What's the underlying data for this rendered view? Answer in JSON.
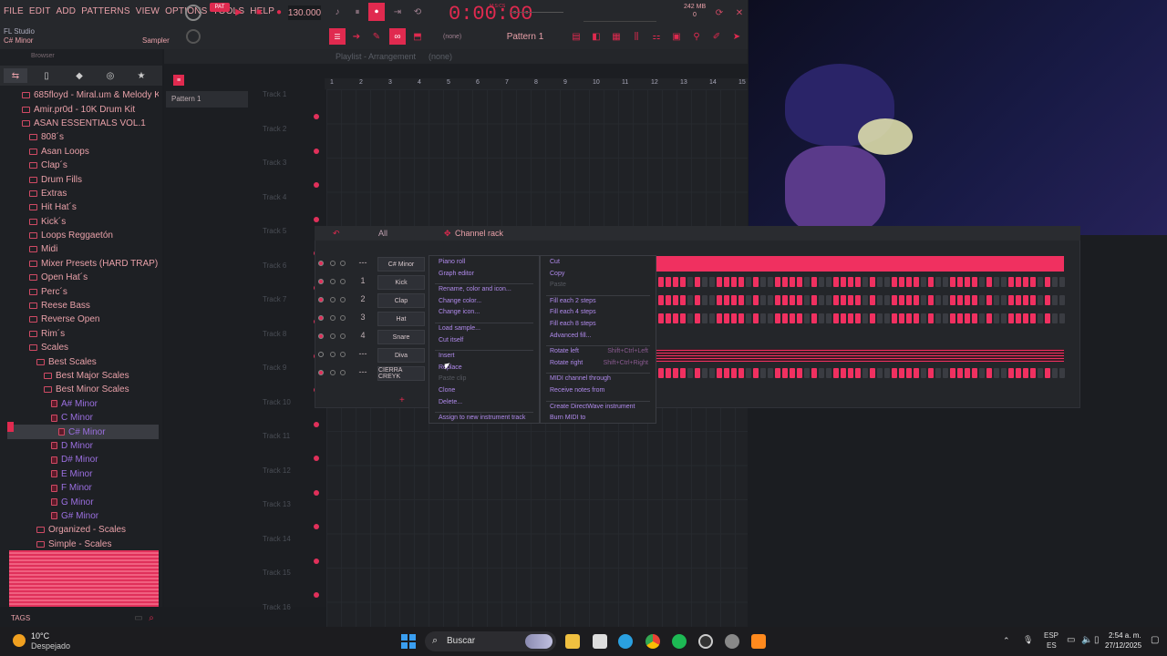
{
  "menu": [
    "FILE",
    "EDIT",
    "ADD",
    "PATTERNS",
    "VIEW",
    "OPTIONS",
    "TOOLS",
    "HELP"
  ],
  "transport": {
    "tempo": "130.000",
    "time": "0:00:00",
    "time_label": "M:S:CS",
    "memory": "242 MB",
    "voices": "0"
  },
  "toolbar2": {
    "pattern": "Pattern 1",
    "none_label": "(none)"
  },
  "hint": {
    "app": "FL Studio",
    "scale": "C# Minor",
    "sampler": "Sampler"
  },
  "browser": {
    "title": "Browser",
    "items": [
      {
        "label": "685floyd - Miral.um & Melody Kit",
        "level": 2,
        "kind": "folder"
      },
      {
        "label": "Amir.pr0d - 10K Drum Kit",
        "level": 2,
        "kind": "folder"
      },
      {
        "label": "ASAN ESSENTIALS VOL.1",
        "level": 2,
        "kind": "folder"
      },
      {
        "label": "808´s",
        "level": 3,
        "kind": "folder"
      },
      {
        "label": "Asan Loops",
        "level": 3,
        "kind": "folder"
      },
      {
        "label": "Clap´s",
        "level": 3,
        "kind": "folder"
      },
      {
        "label": "Drum Fills",
        "level": 3,
        "kind": "folder"
      },
      {
        "label": "Extras",
        "level": 3,
        "kind": "folder"
      },
      {
        "label": "Hit Hat´s",
        "level": 3,
        "kind": "folder"
      },
      {
        "label": "Kick´s",
        "level": 3,
        "kind": "folder"
      },
      {
        "label": "Loops Reggaetón",
        "level": 3,
        "kind": "folder"
      },
      {
        "label": "Midi",
        "level": 3,
        "kind": "folder"
      },
      {
        "label": "Mixer Presets (HARD TRAP)",
        "level": 3,
        "kind": "folder"
      },
      {
        "label": "Open Hat´s",
        "level": 3,
        "kind": "folder"
      },
      {
        "label": "Perc´s",
        "level": 3,
        "kind": "folder"
      },
      {
        "label": "Reese Bass",
        "level": 3,
        "kind": "folder"
      },
      {
        "label": "Reverse Open",
        "level": 3,
        "kind": "folder"
      },
      {
        "label": "Rim´s",
        "level": 3,
        "kind": "folder"
      },
      {
        "label": "Scales",
        "level": 3,
        "kind": "folder"
      },
      {
        "label": "Best Scales",
        "level": 4,
        "kind": "folder"
      },
      {
        "label": "Best Major Scales",
        "level": 5,
        "kind": "folder"
      },
      {
        "label": "Best Minor Scales",
        "level": 5,
        "kind": "folder"
      },
      {
        "label": "A# Minor",
        "level": 6,
        "kind": "file"
      },
      {
        "label": "C Minor",
        "level": 6,
        "kind": "file"
      },
      {
        "label": "C# Minor",
        "level": 7,
        "kind": "file",
        "selected": true
      },
      {
        "label": "D Minor",
        "level": 6,
        "kind": "file"
      },
      {
        "label": "D# Minor",
        "level": 6,
        "kind": "file"
      },
      {
        "label": "E Minor",
        "level": 6,
        "kind": "file"
      },
      {
        "label": "F Minor",
        "level": 6,
        "kind": "file"
      },
      {
        "label": "G Minor",
        "level": 6,
        "kind": "file"
      },
      {
        "label": "G# Minor",
        "level": 6,
        "kind": "file"
      },
      {
        "label": "Organized - Scales",
        "level": 4,
        "kind": "folder"
      },
      {
        "label": "Simple - Scales",
        "level": 4,
        "kind": "folder"
      }
    ],
    "tags_label": "TAGS"
  },
  "playlist": {
    "title": "Playlist - Arrangement",
    "none_label": "(none)",
    "pattern_item": "Pattern 1",
    "ruler": [
      "1",
      "2",
      "3",
      "4",
      "5",
      "6",
      "7",
      "8",
      "9",
      "10",
      "11",
      "12",
      "13",
      "14",
      "15"
    ],
    "tracks": [
      "Track 1",
      "Track 2",
      "Track 3",
      "Track 4",
      "Track 5",
      "Track 6",
      "Track 7",
      "Track 8",
      "Track 9",
      "Track 10",
      "Track 11",
      "Track 12",
      "Track 13",
      "Track 14",
      "Track 15",
      "Track 16"
    ]
  },
  "rack": {
    "title": "Channel rack",
    "filter": "All",
    "channels": [
      {
        "num": "---",
        "name": "C# Minor"
      },
      {
        "num": "1",
        "name": "Kick"
      },
      {
        "num": "2",
        "name": "Clap"
      },
      {
        "num": "3",
        "name": "Hat"
      },
      {
        "num": "4",
        "name": "Snare"
      },
      {
        "num": "---",
        "name": "Diva"
      },
      {
        "num": "---",
        "name": "CIERRA CREYK"
      }
    ],
    "add_label": "+"
  },
  "ctx_left": [
    {
      "label": "Piano roll"
    },
    {
      "label": "Graph editor"
    },
    {
      "sep": true
    },
    {
      "label": "Rename, color and icon..."
    },
    {
      "label": "Change color..."
    },
    {
      "label": "Change icon..."
    },
    {
      "sep": true
    },
    {
      "label": "Load sample..."
    },
    {
      "label": "Cut itself"
    },
    {
      "sep": true
    },
    {
      "label": "Insert"
    },
    {
      "label": "Replace"
    },
    {
      "label": "Paste clip",
      "disabled": true
    },
    {
      "label": "Clone"
    },
    {
      "label": "Delete..."
    },
    {
      "sep": true
    },
    {
      "label": "Assign to new instrument track"
    }
  ],
  "ctx_right": [
    {
      "label": "Cut"
    },
    {
      "label": "Copy"
    },
    {
      "label": "Paste",
      "disabled": true
    },
    {
      "sep": true
    },
    {
      "label": "Fill each 2 steps"
    },
    {
      "label": "Fill each 4 steps"
    },
    {
      "label": "Fill each 8 steps"
    },
    {
      "label": "Advanced fill..."
    },
    {
      "sep": true
    },
    {
      "label": "Rotate left",
      "shortcut": "Shift+Ctrl+Left"
    },
    {
      "label": "Rotate right",
      "shortcut": "Shift+Ctrl+Right"
    },
    {
      "sep": true
    },
    {
      "label": "MIDI channel through"
    },
    {
      "label": "Receive notes from"
    },
    {
      "sep": true
    },
    {
      "label": "Create DirectWave instrument"
    },
    {
      "label": "Burn MIDI to"
    }
  ],
  "taskbar": {
    "weather_temp": "10°C",
    "weather_desc": "Despejado",
    "search": "Buscar",
    "lang1": "ESP",
    "lang2": "ES",
    "time": "2:54 a. m.",
    "date": "27/12/2025"
  },
  "colors": {
    "accent": "#e02a4f",
    "menu_text": "#e8a0a8",
    "file_text": "#9b6fe0"
  }
}
